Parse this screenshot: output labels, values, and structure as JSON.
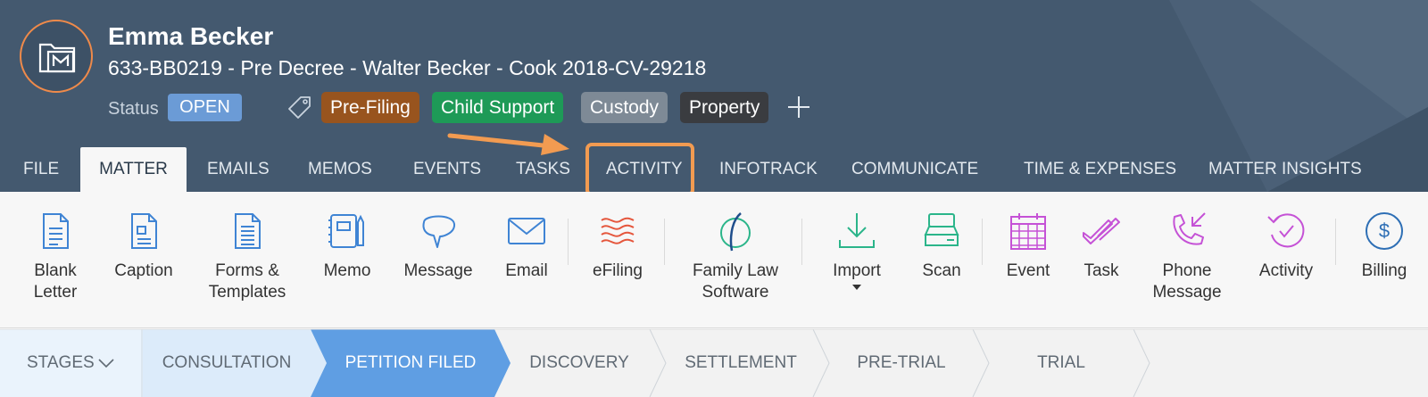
{
  "header": {
    "client_name": "Emma Becker",
    "matter_line": "633-BB0219 - Pre Decree - Walter Becker - Cook 2018-CV-29218",
    "status_label": "Status",
    "status_value": "OPEN",
    "tags": [
      {
        "label": "Pre-Filing",
        "color": "#98541e"
      },
      {
        "label": "Child Support",
        "color": "#1e9a57"
      },
      {
        "label": "Custody",
        "color": "#7e8a96"
      },
      {
        "label": "Property",
        "color": "#3a3c40"
      }
    ],
    "accent_color": "#ef8a4a"
  },
  "tabs": [
    {
      "label": "FILE",
      "active": false
    },
    {
      "label": "MATTER",
      "active": true
    },
    {
      "label": "EMAILS",
      "active": false
    },
    {
      "label": "MEMOS",
      "active": false
    },
    {
      "label": "EVENTS",
      "active": false
    },
    {
      "label": "TASKS",
      "active": false
    },
    {
      "label": "ACTIVITY",
      "active": false,
      "highlighted": true
    },
    {
      "label": "INFOTRACK",
      "active": false
    },
    {
      "label": "COMMUNICATE",
      "active": false
    },
    {
      "label": "TIME & EXPENSES",
      "active": false
    },
    {
      "label": "MATTER INSIGHTS",
      "active": false
    }
  ],
  "ribbon": [
    {
      "label": "Blank Letter",
      "icon": "document-icon",
      "color": "#3f84d4"
    },
    {
      "label": "Caption",
      "icon": "caption-icon",
      "color": "#3f84d4"
    },
    {
      "label": "Forms & Templates",
      "icon": "forms-icon",
      "color": "#3f84d4"
    },
    {
      "label": "Memo",
      "icon": "memo-icon",
      "color": "#3f84d4"
    },
    {
      "label": "Message",
      "icon": "speech-bubble-icon",
      "color": "#3f84d4"
    },
    {
      "label": "Email",
      "icon": "envelope-icon",
      "color": "#3f84d4"
    },
    {
      "label": "eFiling",
      "icon": "efiling-icon",
      "color": "#e5563c"
    },
    {
      "label": "Family Law Software",
      "icon": "family-law-logo-icon",
      "color": "#1a8a5a"
    },
    {
      "label": "Import",
      "icon": "download-icon",
      "color": "#2bb58a"
    },
    {
      "label": "Scan",
      "icon": "scanner-icon",
      "color": "#2bb58a"
    },
    {
      "label": "Event",
      "icon": "calendar-icon",
      "color": "#c552d6"
    },
    {
      "label": "Task",
      "icon": "checkmark-icon",
      "color": "#c552d6"
    },
    {
      "label": "Phone Message",
      "icon": "phone-icon",
      "color": "#c552d6"
    },
    {
      "label": "Activity",
      "icon": "activity-icon",
      "color": "#c552d6"
    },
    {
      "label": "Billing",
      "icon": "dollar-icon",
      "color": "#2e6fb5"
    }
  ],
  "stages": {
    "header": "STAGES",
    "items": [
      {
        "label": "CONSULTATION",
        "state": "done"
      },
      {
        "label": "PETITION FILED",
        "state": "current"
      },
      {
        "label": "DISCOVERY",
        "state": "pending"
      },
      {
        "label": "SETTLEMENT",
        "state": "pending"
      },
      {
        "label": "PRE-TRIAL",
        "state": "pending"
      },
      {
        "label": "TRIAL",
        "state": "pending"
      }
    ]
  }
}
